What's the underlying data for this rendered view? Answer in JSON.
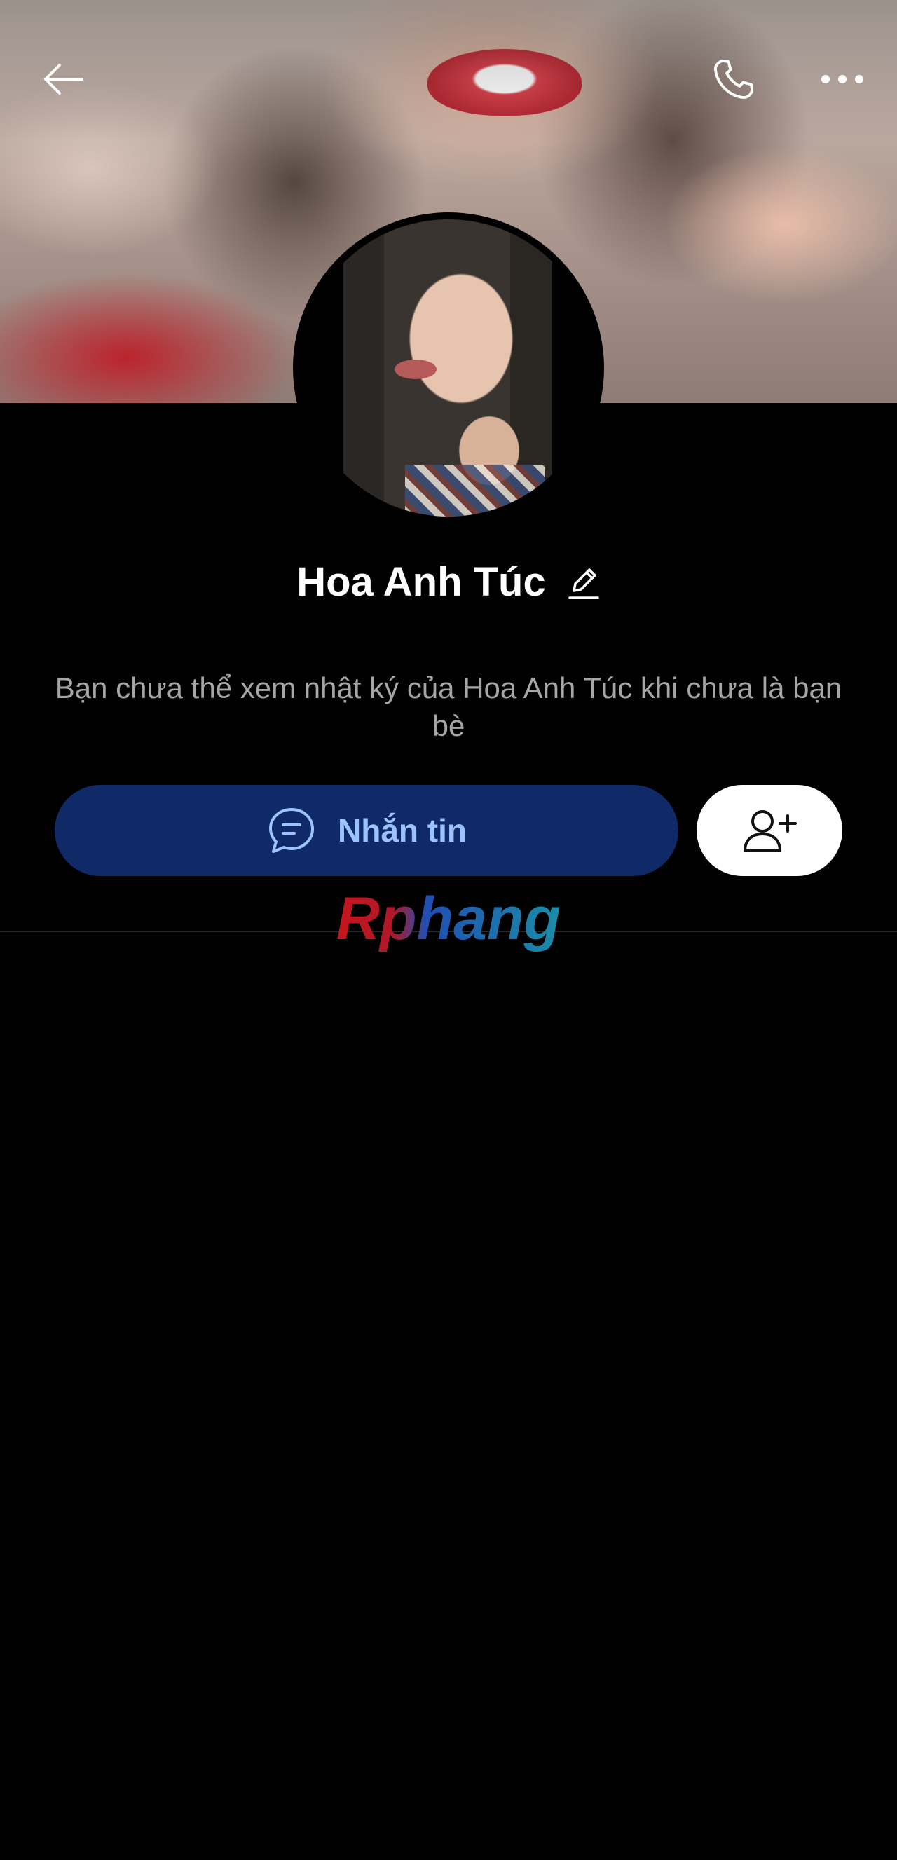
{
  "profile": {
    "name": "Hoa Anh Túc",
    "privacy_notice": "Bạn chưa thể xem nhật ký của Hoa Anh Túc khi chưa là bạn bè"
  },
  "topbar": {
    "back_icon": "arrow-left-icon",
    "call_icon": "phone-icon",
    "more_icon": "more-dots-icon"
  },
  "actions": {
    "message_label": "Nhắn tin",
    "message_icon": "chat-bubble-icon",
    "add_friend_icon": "add-user-icon"
  },
  "watermark": {
    "text": "Rphang"
  },
  "colors": {
    "background": "#000000",
    "message_button": "#0f2a66",
    "message_text": "#9cc3ff",
    "secondary_text": "#a6a6a6"
  }
}
